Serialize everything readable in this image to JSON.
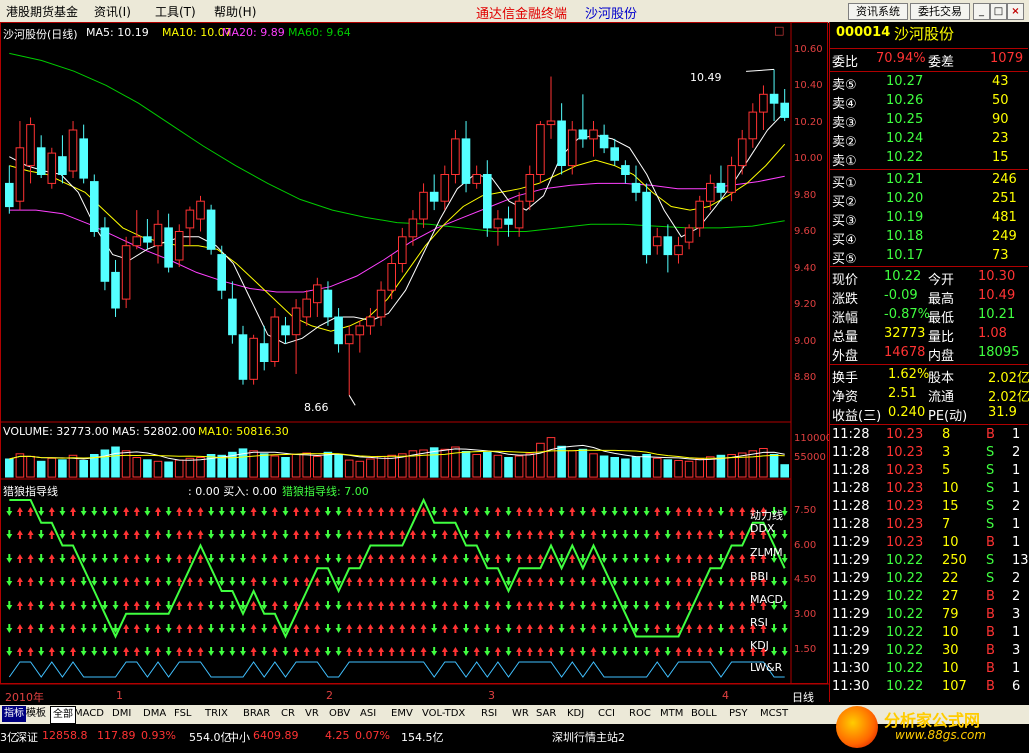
{
  "menubar": {
    "items": [
      "港股期货基金",
      "资讯(I)",
      "工具(T)",
      "帮助(H)"
    ],
    "app_title": "通达信金融终端",
    "stock": "沙河股份",
    "buttons": [
      "资讯系统",
      "委托交易"
    ],
    "window_buttons": [
      "_",
      "□",
      "×"
    ]
  },
  "colors": {
    "up": "#ff3333",
    "down": "#54ffff",
    "ma5": "#ffffff",
    "ma10": "#ffff00",
    "ma20": "#ff40ff",
    "ma60": "#00cc00",
    "indicator": "#40ff40"
  },
  "chart": {
    "header": {
      "name": "沙河股份(日线)",
      "ma5": "MA5: 10.19",
      "ma10": "MA10: 10.07",
      "ma20": "MA20: 9.89",
      "ma60": "MA60: 9.64"
    },
    "y_labels": [
      "10.60",
      "10.40",
      "10.20",
      "10.00",
      "9.80",
      "9.60",
      "9.40",
      "9.20",
      "9.00",
      "8.80"
    ],
    "high_annot": "10.49",
    "low_annot": "8.66",
    "volume_header": {
      "name": "VOLUME: 32773.00",
      "ma5": "MA5: 52802.00",
      "ma10": "MA10: 50816.30"
    },
    "volume_labels": [
      "110000",
      "55000"
    ],
    "indicator_header": {
      "name": "猎狼指导线",
      "values": ": 0.00  买入: 0.00",
      "line": "猎狼指导线: 7.00"
    },
    "indicator_ylabels": [
      "7.50",
      "6.00",
      "4.50",
      "3.00",
      "1.50"
    ],
    "indicator_rows": [
      "动力线",
      "DDX",
      "ZLMM",
      "BBI",
      "MACD",
      "RSI",
      "KDJ",
      "LW&R"
    ],
    "x_axis": [
      "2010年",
      "1",
      "2",
      "3",
      "4"
    ],
    "period": "日线"
  },
  "chart_data": {
    "type": "candlestick",
    "ylim": [
      8.6,
      10.7
    ],
    "candles": [
      [
        9.85,
        9.95,
        9.68,
        9.72
      ],
      [
        9.75,
        10.2,
        9.7,
        10.05
      ],
      [
        9.95,
        10.22,
        9.85,
        10.18
      ],
      [
        10.05,
        10.12,
        9.88,
        9.9
      ],
      [
        9.85,
        10.05,
        9.82,
        10.02
      ],
      [
        10.0,
        10.12,
        9.85,
        9.9
      ],
      [
        9.92,
        10.2,
        9.88,
        10.15
      ],
      [
        10.1,
        10.18,
        9.85,
        9.88
      ],
      [
        9.86,
        9.9,
        9.55,
        9.58
      ],
      [
        9.6,
        9.66,
        9.25,
        9.3
      ],
      [
        9.35,
        9.42,
        9.1,
        9.15
      ],
      [
        9.2,
        9.55,
        9.15,
        9.5
      ],
      [
        9.5,
        9.7,
        9.48,
        9.55
      ],
      [
        9.55,
        9.65,
        9.48,
        9.52
      ],
      [
        9.5,
        9.7,
        9.4,
        9.62
      ],
      [
        9.6,
        9.68,
        9.35,
        9.38
      ],
      [
        9.42,
        9.62,
        9.38,
        9.58
      ],
      [
        9.6,
        9.72,
        9.5,
        9.7
      ],
      [
        9.65,
        9.78,
        9.58,
        9.75
      ],
      [
        9.7,
        9.73,
        9.45,
        9.48
      ],
      [
        9.45,
        9.5,
        9.2,
        9.25
      ],
      [
        9.2,
        9.3,
        8.95,
        9.0
      ],
      [
        9.0,
        9.05,
        8.72,
        8.75
      ],
      [
        8.75,
        9.0,
        8.72,
        8.98
      ],
      [
        8.95,
        9.05,
        8.8,
        8.85
      ],
      [
        8.85,
        9.15,
        8.82,
        9.1
      ],
      [
        9.05,
        9.1,
        8.95,
        9.0
      ],
      [
        9.0,
        9.2,
        8.78,
        9.15
      ],
      [
        9.1,
        9.25,
        9.05,
        9.2
      ],
      [
        9.18,
        9.32,
        9.1,
        9.28
      ],
      [
        9.25,
        9.3,
        9.05,
        9.1
      ],
      [
        9.1,
        9.15,
        8.9,
        8.95
      ],
      [
        8.95,
        9.05,
        8.66,
        9.0
      ],
      [
        9.0,
        9.08,
        8.9,
        9.05
      ],
      [
        9.05,
        9.15,
        9.0,
        9.1
      ],
      [
        9.1,
        9.3,
        9.05,
        9.25
      ],
      [
        9.25,
        9.45,
        9.2,
        9.4
      ],
      [
        9.4,
        9.6,
        9.35,
        9.55
      ],
      [
        9.55,
        9.7,
        9.5,
        9.65
      ],
      [
        9.65,
        9.85,
        9.6,
        9.8
      ],
      [
        9.8,
        9.9,
        9.7,
        9.75
      ],
      [
        9.75,
        9.95,
        9.7,
        9.9
      ],
      [
        9.9,
        10.15,
        9.85,
        10.1
      ],
      [
        10.1,
        10.2,
        9.8,
        9.85
      ],
      [
        9.85,
        9.95,
        9.82,
        9.9
      ],
      [
        9.9,
        9.98,
        9.55,
        9.6
      ],
      [
        9.6,
        9.7,
        9.5,
        9.65
      ],
      [
        9.65,
        9.72,
        9.55,
        9.62
      ],
      [
        9.6,
        9.8,
        9.55,
        9.75
      ],
      [
        9.75,
        9.95,
        9.7,
        9.9
      ],
      [
        9.9,
        10.2,
        9.85,
        10.18
      ],
      [
        10.18,
        10.45,
        10.1,
        10.2
      ],
      [
        10.2,
        10.3,
        9.9,
        9.95
      ],
      [
        9.95,
        10.2,
        9.9,
        10.15
      ],
      [
        10.15,
        10.35,
        10.05,
        10.1
      ],
      [
        10.1,
        10.2,
        10.0,
        10.15
      ],
      [
        10.12,
        10.18,
        10.02,
        10.05
      ],
      [
        10.05,
        10.1,
        9.95,
        9.98
      ],
      [
        9.95,
        9.98,
        9.85,
        9.9
      ],
      [
        9.85,
        9.95,
        9.75,
        9.8
      ],
      [
        9.8,
        9.85,
        9.4,
        9.45
      ],
      [
        9.5,
        9.6,
        9.45,
        9.55
      ],
      [
        9.55,
        9.62,
        9.35,
        9.45
      ],
      [
        9.45,
        9.55,
        9.4,
        9.5
      ],
      [
        9.52,
        9.62,
        9.48,
        9.6
      ],
      [
        9.6,
        9.78,
        9.55,
        9.75
      ],
      [
        9.75,
        9.9,
        9.7,
        9.85
      ],
      [
        9.85,
        9.95,
        9.75,
        9.8
      ],
      [
        9.8,
        10.0,
        9.75,
        9.95
      ],
      [
        9.95,
        10.15,
        9.9,
        10.1
      ],
      [
        10.1,
        10.3,
        10.05,
        10.25
      ],
      [
        10.25,
        10.4,
        10.15,
        10.35
      ],
      [
        10.35,
        10.49,
        10.2,
        10.3
      ],
      [
        10.3,
        10.38,
        10.2,
        10.22
      ]
    ],
    "ma5": [
      10.0,
      9.95,
      9.92,
      9.9,
      9.8,
      9.6,
      9.45,
      9.42,
      9.48,
      9.52,
      9.55,
      9.55,
      9.5,
      9.4,
      9.2,
      9.0,
      8.95,
      8.98,
      9.05,
      9.1,
      9.1,
      9.08,
      9.12,
      9.25,
      9.45,
      9.65,
      9.82,
      9.9,
      9.88,
      9.75,
      9.7,
      9.78,
      10.0,
      10.1,
      10.12,
      10.1,
      10.05,
      9.9,
      9.7,
      9.55,
      9.6,
      9.72,
      9.85,
      10.0,
      10.15,
      10.25
    ],
    "ma10": [
      9.95,
      9.92,
      9.9,
      9.85,
      9.8,
      9.7,
      9.6,
      9.55,
      9.52,
      9.5,
      9.5,
      9.48,
      9.4,
      9.3,
      9.2,
      9.1,
      9.05,
      9.02,
      9.05,
      9.1,
      9.2,
      9.35,
      9.5,
      9.62,
      9.72,
      9.78,
      9.8,
      9.82,
      9.85,
      9.9,
      9.95,
      9.98,
      9.95,
      9.9,
      9.8,
      9.72,
      9.7,
      9.72,
      9.78,
      9.85,
      9.95,
      10.07
    ],
    "ma20": [
      9.7,
      9.7,
      9.68,
      9.62,
      9.55,
      9.48,
      9.42,
      9.35,
      9.3,
      9.26,
      9.24,
      9.24,
      9.27,
      9.33,
      9.42,
      9.52,
      9.6,
      9.66,
      9.72,
      9.78,
      9.82,
      9.84,
      9.85,
      9.85,
      9.84,
      9.82,
      9.82,
      9.84,
      9.86,
      9.89
    ],
    "ma60": [
      10.58,
      10.54,
      10.48,
      10.4,
      10.3,
      10.18,
      10.06,
      9.95,
      9.85,
      9.76,
      9.7,
      9.66,
      9.63,
      9.62,
      9.6,
      9.58,
      9.58,
      9.6,
      9.62,
      9.62,
      9.61,
      9.6,
      9.6,
      9.61,
      9.64
    ],
    "volume": [
      48000,
      62000,
      55000,
      42000,
      50000,
      46000,
      58000,
      44000,
      60000,
      72000,
      80000,
      70000,
      52000,
      46000,
      42000,
      40000,
      45000,
      50000,
      52000,
      60000,
      58000,
      66000,
      75000,
      70000,
      62000,
      56000,
      52000,
      60000,
      64000,
      55000,
      66000,
      60000,
      45000,
      42000,
      48000,
      55000,
      58000,
      62000,
      70000,
      72000,
      78000,
      74000,
      80000,
      68000,
      60000,
      66000,
      58000,
      52000,
      56000,
      62000,
      90000,
      105000,
      82000,
      70000,
      74000,
      62000,
      56000,
      52000,
      48000,
      54000,
      60000,
      50000,
      46000,
      44000,
      42000,
      48000,
      54000,
      58000,
      60000,
      64000,
      70000,
      76000,
      60000,
      32773
    ]
  },
  "quote": {
    "code": "000014",
    "name": "沙河股份",
    "weibi_label": "委比",
    "weibi_value": "70.94%",
    "weicha_label": "委差",
    "weicha_value": "1079",
    "asks": [
      {
        "label": "卖⑤",
        "price": "10.27",
        "vol": "43"
      },
      {
        "label": "卖④",
        "price": "10.26",
        "vol": "50"
      },
      {
        "label": "卖③",
        "price": "10.25",
        "vol": "90"
      },
      {
        "label": "卖②",
        "price": "10.24",
        "vol": "23"
      },
      {
        "label": "卖①",
        "price": "10.22",
        "vol": "15"
      }
    ],
    "bids": [
      {
        "label": "买①",
        "price": "10.21",
        "vol": "246"
      },
      {
        "label": "买②",
        "price": "10.20",
        "vol": "251"
      },
      {
        "label": "买③",
        "price": "10.19",
        "vol": "481"
      },
      {
        "label": "买④",
        "price": "10.18",
        "vol": "249"
      },
      {
        "label": "买⑤",
        "price": "10.17",
        "vol": "73"
      }
    ],
    "stats1": [
      {
        "l1": "现价",
        "v1": "10.22",
        "l2": "今开",
        "v2": "10.30"
      },
      {
        "l1": "涨跌",
        "v1": "-0.09",
        "l2": "最高",
        "v2": "10.49"
      },
      {
        "l1": "涨幅",
        "v1": "-0.87%",
        "l2": "最低",
        "v2": "10.21"
      },
      {
        "l1": "总量",
        "v1": "32773",
        "l2": "量比",
        "v2": "1.08"
      },
      {
        "l1": "外盘",
        "v1": "14678",
        "l2": "内盘",
        "v2": "18095"
      }
    ],
    "stats2": [
      {
        "l1": "换手",
        "v1": "1.62%",
        "l2": "股本",
        "v2": "2.02亿"
      },
      {
        "l1": "净资",
        "v1": "2.51",
        "l2": "流通",
        "v2": "2.02亿"
      },
      {
        "l1": "收益(三)",
        "v1": "0.240",
        "l2": "PE(动)",
        "v2": "31.9"
      }
    ],
    "ticks": [
      {
        "t": "11:28",
        "p": "10.23",
        "v": "8",
        "s": "B",
        "n": "1"
      },
      {
        "t": "11:28",
        "p": "10.23",
        "v": "3",
        "s": "S",
        "n": "2"
      },
      {
        "t": "11:28",
        "p": "10.23",
        "v": "5",
        "s": "S",
        "n": "1"
      },
      {
        "t": "11:28",
        "p": "10.23",
        "v": "10",
        "s": "S",
        "n": "1"
      },
      {
        "t": "11:28",
        "p": "10.23",
        "v": "15",
        "s": "S",
        "n": "2"
      },
      {
        "t": "11:28",
        "p": "10.23",
        "v": "7",
        "s": "S",
        "n": "1"
      },
      {
        "t": "11:29",
        "p": "10.23",
        "v": "10",
        "s": "B",
        "n": "1"
      },
      {
        "t": "11:29",
        "p": "10.22",
        "v": "250",
        "s": "S",
        "n": "13"
      },
      {
        "t": "11:29",
        "p": "10.22",
        "v": "22",
        "s": "S",
        "n": "2"
      },
      {
        "t": "11:29",
        "p": "10.22",
        "v": "27",
        "s": "B",
        "n": "2"
      },
      {
        "t": "11:29",
        "p": "10.22",
        "v": "79",
        "s": "B",
        "n": "3"
      },
      {
        "t": "11:29",
        "p": "10.22",
        "v": "10",
        "s": "B",
        "n": "1"
      },
      {
        "t": "11:29",
        "p": "10.22",
        "v": "30",
        "s": "B",
        "n": "3"
      },
      {
        "t": "11:30",
        "p": "10.22",
        "v": "10",
        "s": "B",
        "n": "1"
      },
      {
        "t": "11:30",
        "p": "10.22",
        "v": "107",
        "s": "B",
        "n": "6"
      }
    ]
  },
  "tabs": [
    "指标",
    "模板",
    "全部",
    "MACD",
    "DMI",
    "DMA",
    "FSL",
    "TRIX",
    "BRAR",
    "CR",
    "VR",
    "OBV",
    "ASI",
    "EMV",
    "VOL-TDX",
    "RSI",
    "WR",
    "SAR",
    "KDJ",
    "CCI",
    "ROC",
    "MTM",
    "BOLL",
    "PSY",
    "MCST"
  ],
  "status": {
    "amount": "3亿",
    "index_name": "深证",
    "index_value": "12858.8",
    "index_change": "117.89",
    "index_pct": "0.93%",
    "index_amount": "554.0亿",
    "small_name": "中小",
    "small_value": "6409.89",
    "small_change": "4.25",
    "small_pct": "0.07%",
    "small_amount": "154.5亿",
    "site": "深圳行情主站2",
    "watermark": "分析家公式网",
    "watermark_url": "www.88gs.com"
  }
}
